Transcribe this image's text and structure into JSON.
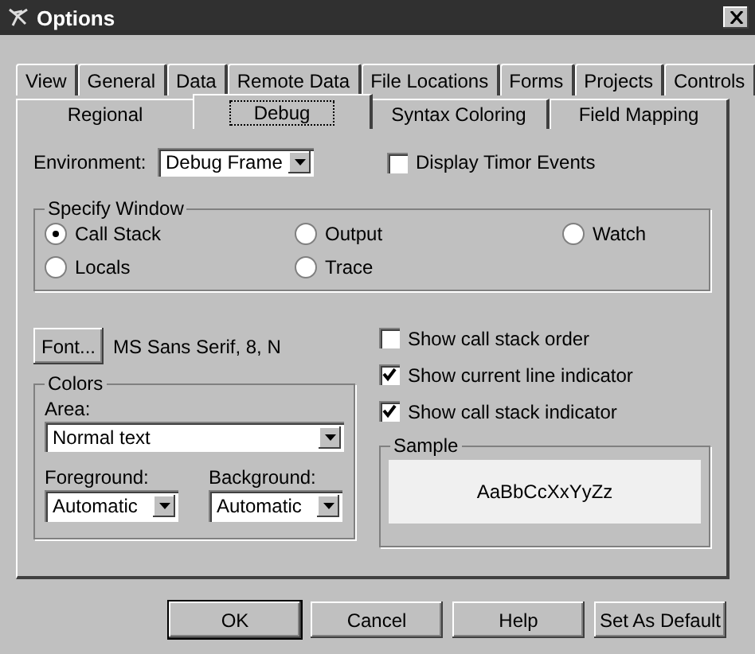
{
  "window": {
    "title": "Options"
  },
  "tabs_row1": [
    {
      "label": "View",
      "selected": false
    },
    {
      "label": "General",
      "selected": false
    },
    {
      "label": "Data",
      "selected": false
    },
    {
      "label": "Remote Data",
      "selected": false
    },
    {
      "label": "File Locations",
      "selected": false
    },
    {
      "label": "Forms",
      "selected": false
    },
    {
      "label": "Projects",
      "selected": false
    },
    {
      "label": "Controls",
      "selected": false
    }
  ],
  "tabs_row2": [
    {
      "label": "Regional",
      "selected": false
    },
    {
      "label": "Debug",
      "selected": true
    },
    {
      "label": "Syntax Coloring",
      "selected": false
    },
    {
      "label": "Field Mapping",
      "selected": false
    }
  ],
  "environment": {
    "label": "Environment:",
    "value": "Debug Frame"
  },
  "display_timer_events": {
    "label": "Display Timor Events",
    "checked": false
  },
  "specify_window": {
    "title": "Specify Window",
    "options": [
      {
        "label": "Call Stack",
        "selected": true
      },
      {
        "label": "Output",
        "selected": false
      },
      {
        "label": "Watch",
        "selected": false
      },
      {
        "label": "Locals",
        "selected": false
      },
      {
        "label": "Trace",
        "selected": false
      }
    ]
  },
  "font": {
    "button": "Font...",
    "value": "MS Sans Serif, 8, N"
  },
  "colors": {
    "title": "Colors",
    "area_label": "Area:",
    "area_value": "Normal text",
    "foreground_label": "Foreground:",
    "foreground_value": "Automatic",
    "background_label": "Background:",
    "background_value": "Automatic"
  },
  "checkboxes": [
    {
      "label": "Show call stack order",
      "checked": false
    },
    {
      "label": "Show current line indicator",
      "checked": true
    },
    {
      "label": "Show call stack indicator",
      "checked": true
    }
  ],
  "sample": {
    "title": "Sample",
    "text": "AaBbCcXxYyZz"
  },
  "buttons": [
    {
      "label": "OK",
      "default": true
    },
    {
      "label": "Cancel",
      "default": false
    },
    {
      "label": "Help",
      "default": false
    },
    {
      "label": "Set As Default",
      "default": false
    }
  ]
}
